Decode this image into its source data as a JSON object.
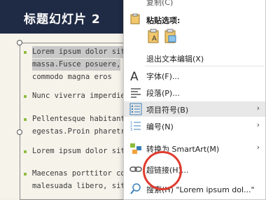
{
  "slide": {
    "title": "标题幻灯片 2",
    "bullets": [
      {
        "lines": [
          "Lorem ipsum dolor sit",
          "massa.Fusce posuere,",
          "commodo magna eros"
        ]
      },
      {
        "lines": [
          "Nunc viverra imperdie"
        ]
      },
      {
        "lines": [
          "Pellentesque habitant",
          "egestas.Proin pharetra"
        ]
      },
      {
        "lines": [
          "Lorem ipsum dolor sit"
        ]
      },
      {
        "lines": [
          "Maecenas porttitor co",
          "malesuada libero, sit a"
        ]
      }
    ]
  },
  "context_menu": {
    "top_partial": "复制(C)",
    "paste_options_label": "粘贴选项:",
    "items": [
      {
        "label": "退出文本编辑(X)",
        "icon": "none-icon"
      },
      {
        "label": "字体(F)...",
        "icon": "font-icon"
      },
      {
        "label": "段落(P)...",
        "icon": "paragraph-icon"
      },
      {
        "label": "项目符号(B)",
        "icon": "bullets-icon",
        "submenu": true
      },
      {
        "label": "编号(N)",
        "icon": "numbering-icon",
        "submenu": true
      },
      {
        "label": "转换为 SmartArt(M)",
        "icon": "smartart-icon",
        "submenu": true
      },
      {
        "label": "超链接(H)...",
        "icon": "link-icon"
      },
      {
        "label": "搜索(H) \"Lorem ipsum dol...\"",
        "icon": "search-icon"
      }
    ],
    "submenu_arrow": "›"
  },
  "colors": {
    "title_bar": "#1f2a44",
    "bullet": "#8dbb3a",
    "highlight_circle": "#e03b2f"
  }
}
